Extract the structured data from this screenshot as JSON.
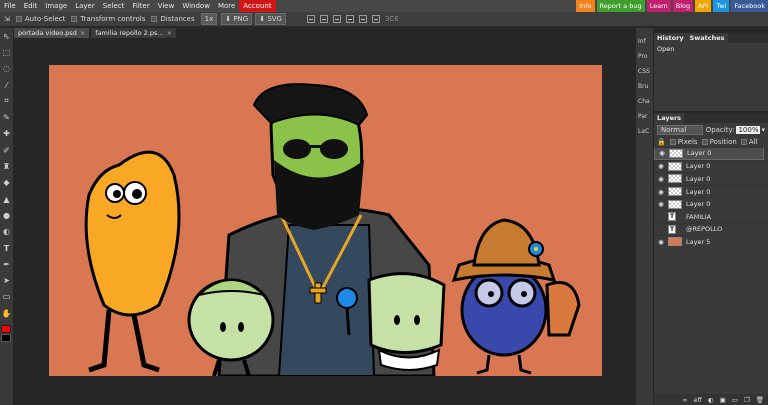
{
  "menu": [
    "File",
    "Edit",
    "Image",
    "Layer",
    "Select",
    "Filter",
    "View",
    "Window",
    "More",
    "Account"
  ],
  "top_right": [
    {
      "label": "Info",
      "color": "#f4821f"
    },
    {
      "label": "Report a bug",
      "color": "#3f9e2e"
    },
    {
      "label": "Learn",
      "color": "#c2206f"
    },
    {
      "label": "Blog",
      "color": "#c2206f"
    },
    {
      "label": "API",
      "color": "#f0a500"
    },
    {
      "label": "Twi",
      "color": "#1b95e0"
    },
    {
      "label": "Facebook",
      "color": "#3b5998"
    }
  ],
  "options": {
    "auto_select": "Auto-Select",
    "transform_controls": "Transform controls",
    "distances": "Distances",
    "zoom": "1x",
    "png": "PNG",
    "svg": "SVG",
    "extra": "3C6"
  },
  "tabs": [
    {
      "label": "portada video.psd",
      "close": "×"
    },
    {
      "label": "familia repollo 2.ps...",
      "close": "×"
    }
  ],
  "mini_panel": [
    "Inf",
    "Pro",
    "CSS",
    "Bru",
    "Cha",
    "Par",
    "LaC"
  ],
  "history": {
    "tabs": [
      "History",
      "Swatches"
    ],
    "items": [
      "Open"
    ]
  },
  "layers": {
    "title": "Layers",
    "blend_mode": "Normal",
    "opacity_label": "Opacity:",
    "opacity_value": "100%",
    "lock_labels": [
      "Pixels",
      "Position",
      "All"
    ],
    "items": [
      {
        "name": "Layer 0",
        "kind": "checker",
        "visible": true,
        "selected": true
      },
      {
        "name": "Layer 0",
        "kind": "checker",
        "visible": true,
        "selected": false
      },
      {
        "name": "Layer 0",
        "kind": "checker",
        "visible": true,
        "selected": false
      },
      {
        "name": "Layer 0",
        "kind": "checker",
        "visible": true,
        "selected": false
      },
      {
        "name": "Layer 0",
        "kind": "checker",
        "visible": true,
        "selected": false
      },
      {
        "name": "FAMILIA",
        "kind": "text",
        "visible": false,
        "selected": false
      },
      {
        "name": "@REPOLLO",
        "kind": "text",
        "visible": false,
        "selected": false
      },
      {
        "name": "Layer 5",
        "kind": "fill",
        "visible": true,
        "selected": false
      }
    ],
    "footer": [
      "eff"
    ]
  },
  "canvas": {
    "background": "#d97753"
  }
}
